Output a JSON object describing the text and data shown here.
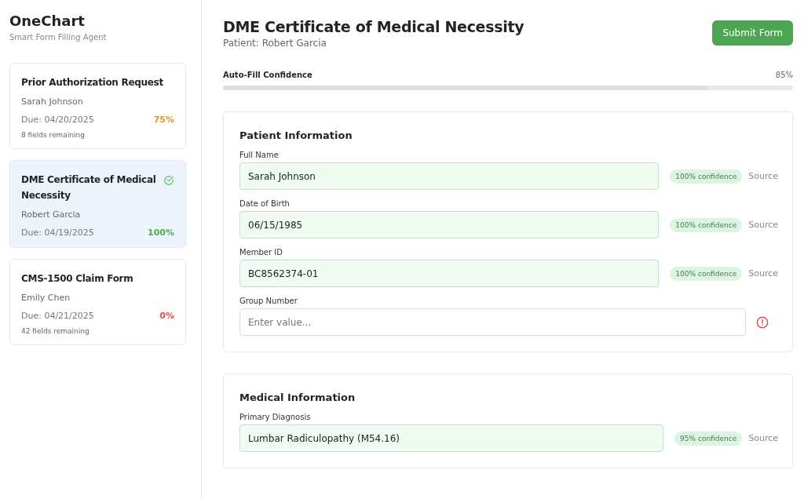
{
  "app": {
    "title": "OneChart",
    "subtitle": "Smart Form Filling Agent"
  },
  "forms": [
    {
      "title": "Prior Authorization Request",
      "patient": "Sarah Johnson",
      "due": "Due: 04/20/2025",
      "percent": "75%",
      "color": "#d4982c",
      "remaining": "8 fields remaining",
      "complete": false,
      "selected": false
    },
    {
      "title": "DME Certificate of Medical Necessity",
      "patient": "Robert Garcia",
      "due": "Due: 04/19/2025",
      "percent": "100%",
      "color": "#4caf50",
      "complete": true,
      "selected": true
    },
    {
      "title": "CMS-1500 Claim Form",
      "patient": "Emily Chen",
      "due": "Due: 04/21/2025",
      "percent": "0%",
      "color": "#e05252",
      "remaining": "42 fields remaining",
      "complete": false,
      "selected": false
    }
  ],
  "header": {
    "title": "DME Certificate of Medical Necessity",
    "patient": "Patient: Robert Garcia",
    "button": "Submit Form"
  },
  "confidence": {
    "label": "Auto-Fill Confidence",
    "reading": "85%",
    "level": 0.85
  },
  "sections": [
    {
      "title": "Patient Information",
      "fields": [
        {
          "kind": "filled",
          "label": "Full Name",
          "value": "Sarah Johnson",
          "badge": "100% confidence",
          "source": "Source"
        },
        {
          "kind": "filled",
          "label": "Date of Birth",
          "value": "06/15/1985",
          "badge": "100% confidence",
          "source": "Source"
        },
        {
          "kind": "filled",
          "label": "Member ID",
          "value": "BC8562374-01",
          "badge": "100% confidence",
          "source": "Source"
        },
        {
          "kind": "empty",
          "label": "Group Number",
          "placeholder": "Enter value..."
        }
      ]
    },
    {
      "title": "Medical Information",
      "fields": [
        {
          "kind": "filled",
          "label": "Primary Diagnosis",
          "value": "Lumbar Radiculopathy (M54.16)",
          "badge": "95% confidence",
          "source": "Source"
        }
      ]
    }
  ]
}
